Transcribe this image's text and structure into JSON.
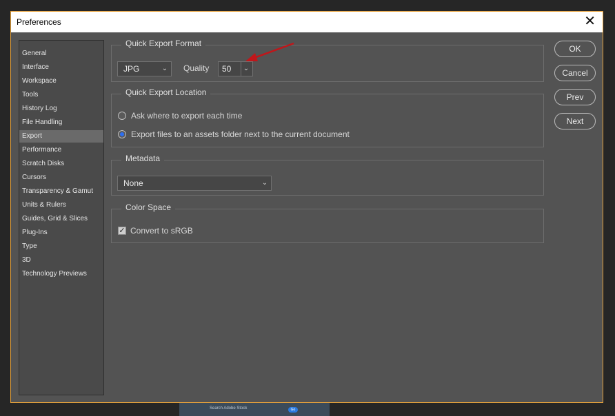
{
  "window": {
    "title": "Preferences"
  },
  "sidebar": {
    "items": [
      {
        "label": "General"
      },
      {
        "label": "Interface"
      },
      {
        "label": "Workspace"
      },
      {
        "label": "Tools"
      },
      {
        "label": "History Log"
      },
      {
        "label": "File Handling"
      },
      {
        "label": "Export",
        "selected": true
      },
      {
        "label": "Performance"
      },
      {
        "label": "Scratch Disks"
      },
      {
        "label": "Cursors"
      },
      {
        "label": "Transparency & Gamut"
      },
      {
        "label": "Units & Rulers"
      },
      {
        "label": "Guides, Grid & Slices"
      },
      {
        "label": "Plug-Ins"
      },
      {
        "label": "Type"
      },
      {
        "label": "3D"
      },
      {
        "label": "Technology Previews"
      }
    ]
  },
  "quick_export_format": {
    "legend": "Quick Export Format",
    "format_value": "JPG",
    "quality_label": "Quality",
    "quality_value": "50"
  },
  "quick_export_location": {
    "legend": "Quick Export Location",
    "option_ask": "Ask where to export each time",
    "option_assets": "Export files to an assets folder next to the current document",
    "selected": "assets"
  },
  "metadata": {
    "legend": "Metadata",
    "value": "None"
  },
  "color_space": {
    "legend": "Color Space",
    "convert_label": "Convert to sRGB",
    "checked": true
  },
  "buttons": {
    "ok": "OK",
    "cancel": "Cancel",
    "prev": "Prev",
    "next": "Next"
  },
  "footer": {
    "search_placeholder": "Search Adobe Stock",
    "go": "Go"
  },
  "colors": {
    "accent_border": "#e8a33b",
    "arrow": "#c0161a",
    "radio_on": "#2d6ff2"
  }
}
